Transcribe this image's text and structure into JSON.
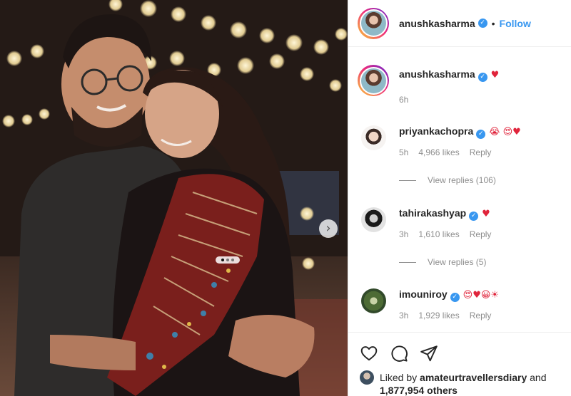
{
  "post": {
    "author": "anushkasharma",
    "verified_mark": "✓",
    "separator": "•",
    "follow_label": "Follow"
  },
  "caption": {
    "username": "anushkasharma",
    "emoji": "♥",
    "time": "6h"
  },
  "comments": [
    {
      "username": "priyankachopra",
      "emoji": "😭 😍♥",
      "time": "5h",
      "likes": "4,966 likes",
      "reply_label": "Reply",
      "view_replies": "View replies (106)"
    },
    {
      "username": "tahirakashyap",
      "emoji": "♥",
      "time": "3h",
      "likes": "1,610 likes",
      "reply_label": "Reply",
      "view_replies": "View replies (5)"
    },
    {
      "username": "imouniroy",
      "emoji": "😍♥😀☀",
      "time": "3h",
      "likes": "1,929 likes",
      "reply_label": "Reply"
    }
  ],
  "likes": {
    "prefix": "Liked by",
    "user": "amateurtravellersdiary",
    "conj": "and",
    "count": "1,877,954 others"
  },
  "icons": {
    "like": "heart-icon",
    "comment": "comment-icon",
    "share": "share-icon",
    "next": "chevron-right-icon"
  },
  "carousel": {
    "next_glyph": "›",
    "current_slide": 1,
    "total_slides": 3
  },
  "colors": {
    "link": "#3897f0",
    "heart": "#e0243b",
    "muted": "#8e8e8e"
  }
}
